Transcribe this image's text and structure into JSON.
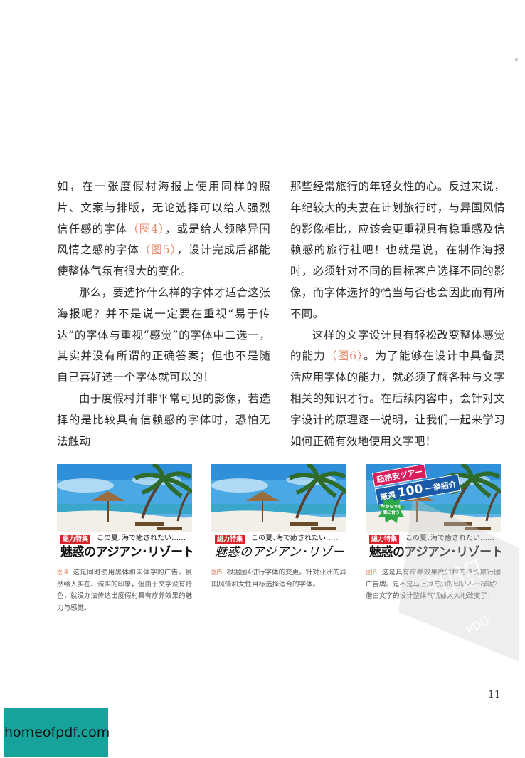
{
  "body": {
    "left_paragraphs": [
      {
        "segments": [
          {
            "text": "如，在一张度假村海报上使用同样的照片、文案与排版，无论选择可以给人强烈信任感的字体",
            "ref": false
          },
          {
            "text": "（图4）",
            "ref": true
          },
          {
            "text": "，或是给人领略异国风情之感的字体",
            "ref": false
          },
          {
            "text": "（图5）",
            "ref": true
          },
          {
            "text": "，设计完成后都能使整体气氛有很大的变化。",
            "ref": false
          }
        ]
      },
      {
        "segments": [
          {
            "text": "那么，要选择什么样的字体才适合这张海报呢？并不是说一定要在重视“易于传达”的字体与重视“感觉”的字体中二选一，其实并没有所谓的正确答案；但也不是随自己喜好选一个字体就可以的！",
            "ref": false
          }
        ]
      },
      {
        "segments": [
          {
            "text": "由于度假村并非平常可见的影像，若选择的是比较具有信赖感的字体时，恐怕无法触动",
            "ref": false
          }
        ]
      }
    ],
    "right_paragraphs": [
      {
        "segments": [
          {
            "text": "那些经常旅行的年轻女性的心。反过来说，年纪较大的夫妻在计划旅行时，与异国风情的影像相比，应该会更重视具有稳重感及信赖感的旅行社吧！也就是说，在制作海报时，必须针对不同的目标客户选择不同的影像，而字体选择的恰当与否也会因此而有所不同。",
            "ref": false
          }
        ]
      },
      {
        "segments": [
          {
            "text": "这样的文字设计具有轻松改变整体感觉的能力",
            "ref": false
          },
          {
            "text": "（图6）",
            "ref": true
          },
          {
            "text": "。为了能够在设计中具备灵活应用字体的能力，就必须了解各种与文字相关的知识才行。在后续内容中，会针对文字设计的原理逐一说明，让我们一起来学习如何正确有效地使用文字吧！",
            "ref": false
          }
        ]
      }
    ]
  },
  "figures": [
    {
      "tag": "総力特集",
      "tagline": "この夏､海で癒されたい……",
      "headline": "魅惑のアジアン･リゾート",
      "caption_num": "图4",
      "caption": "这是同时使用黑体和宋体字的广告。虽然给人实在、诚实的印象，但由于文字没有特色，就没办法传达出度假村具有疗养效果的魅力与感觉。"
    },
    {
      "tag": "総力特集",
      "tagline": "この夏､海で癒されたい……",
      "headline": "魅惑のアジアン･リゾート",
      "caption_num": "图5",
      "caption": "根据图4进行字体的变更。针对亚洲的异国风情和女性目标选择适合的字体。"
    },
    {
      "tag": "総力特集",
      "tagline": "この夏､海で癒されたい……",
      "headline": "魅惑のアジアン･リゾート",
      "promo_top": "超格安ツアー",
      "promo_mid_prefix": "厳選",
      "promo_mid_number": "100",
      "promo_mid_suffix": "一挙紹介",
      "promo_burst": "今からでも間に合う",
      "caption_num": "图6",
      "caption": "这是具有疗养效果度假村的特价旅行团广告牌。是不是马上跟前面的印象不一样呢？借由文字的设计整体气氛都大大地改变了！"
    }
  ],
  "page_number": "11",
  "watermark": {
    "chars": "知识",
    "latin": "PDG"
  },
  "site_logo": "homeofpdf.com",
  "colors": {
    "figure_ref": "#e58a6a",
    "tag_red": "#d8232a",
    "sky": "#5fb2e6",
    "sea": "#3aa6c9",
    "logo_bg": "#17a29b"
  }
}
